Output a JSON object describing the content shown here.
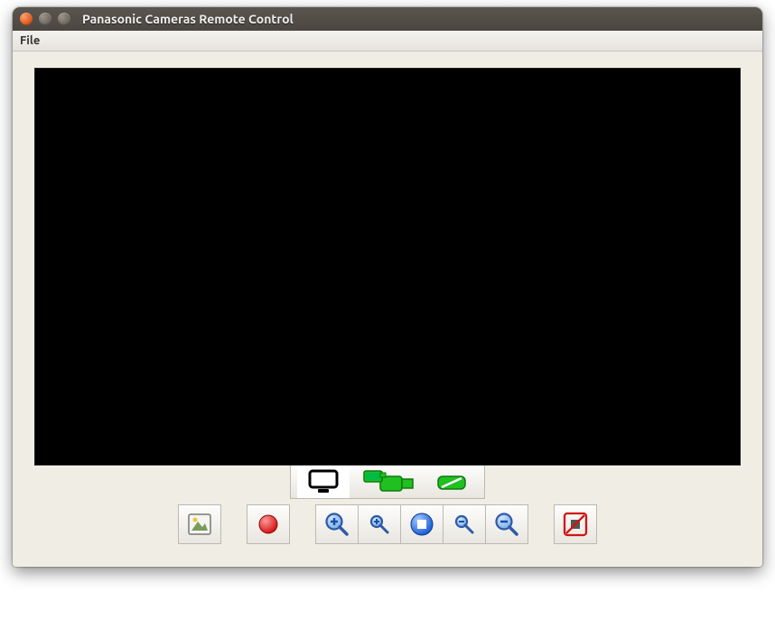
{
  "window": {
    "title": "Panasonic Cameras Remote Control"
  },
  "menu": {
    "file": "File"
  },
  "tabs": [
    {
      "name": "display-tab",
      "icon": "monitor-icon"
    },
    {
      "name": "camera-tab",
      "icon": "camcorder-icon"
    },
    {
      "name": "connection-tab",
      "icon": "handshake-icon"
    }
  ],
  "toolbar": {
    "snapshot": "Snapshot",
    "record": "Record",
    "zoom_in": "Zoom In",
    "zoom_in_step": "Zoom In Step",
    "zoom_reset": "Zoom Reset",
    "zoom_out_step": "Zoom Out Step",
    "zoom_out": "Zoom Out",
    "disable": "Disable"
  }
}
